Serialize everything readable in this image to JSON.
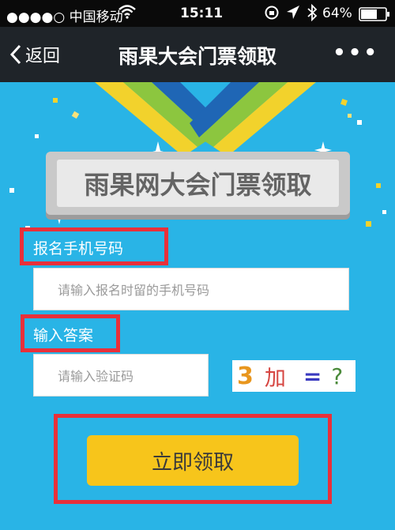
{
  "status_bar": {
    "carrier": "●●●●○ 中国移动",
    "time": "15:11",
    "battery": "64%",
    "icons": [
      "wifi-icon",
      "lock-rotation-icon",
      "location-arrow-icon",
      "bluetooth-icon",
      "battery-icon"
    ]
  },
  "navbar": {
    "back_label": "返回",
    "title": "雨果大会门票领取",
    "more_label": "•••"
  },
  "form": {
    "banner_title": "雨果网大会门票领取",
    "phone_label": "报名手机号码",
    "phone_placeholder": "请输入报名时留的手机号码",
    "answer_label": "输入答案",
    "code_placeholder": "请输入验证码",
    "captcha": {
      "num": "3",
      "op": "加",
      "eq": "=",
      "q": "?"
    },
    "submit_label": "立即领取"
  },
  "colors": {
    "background": "#29b4e6",
    "navbar": "#1f2429",
    "button": "#f7c51b",
    "highlight_box": "#e8303a",
    "ribbon_blue": "#1f66b5",
    "ribbon_green": "#8cc63f",
    "ribbon_yellow": "#f2d22c"
  }
}
